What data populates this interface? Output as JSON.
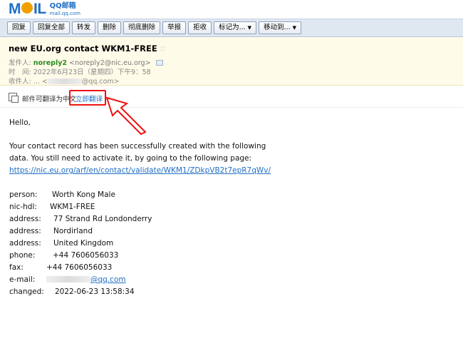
{
  "logo": {
    "mail": "MAIL",
    "qq": "QQ邮箱",
    "url": "mail.qq.com"
  },
  "toolbar": {
    "buttons": [
      "回复",
      "回复全部",
      "转发",
      "删除",
      "彻底删除",
      "举报",
      "拒收"
    ],
    "mark_as": "标记为...",
    "move_to": "移动到..."
  },
  "header": {
    "subject": "new EU.org contact WKM1-FREE",
    "from_label": "发件人:",
    "sender_name": "noreply2",
    "sender_email": "<noreply2@nic.eu.org>",
    "time_label": "时　间:",
    "time_value": "2022年6月23日（星期四）下午9：58",
    "to_label": "收件人:",
    "to_prefix": "...",
    "to_lt": "<",
    "to_suffix": "@qq.com>"
  },
  "translate": {
    "text": "邮件可翻译为中文",
    "link": "立即翻译"
  },
  "body": {
    "greeting": "Hello,",
    "p1": "Your contact record has been successfully created with the following",
    "p2": "data. You still need to activate it, by going to the following page:",
    "url": "https://nic.eu.org/arf/en/contact/validate/WKM1/ZDkpVB2t7epR7qWv/",
    "fields": {
      "person": {
        "label": "person:",
        "value": "Worth Kong Male"
      },
      "nichdl": {
        "label": "nic-hdl:",
        "value": "WKM1-FREE"
      },
      "address1": {
        "label": "address:",
        "value": "77 Strand Rd Londonderry"
      },
      "address2": {
        "label": "address:",
        "value": "Nordirland"
      },
      "address3": {
        "label": "address:",
        "value": "United Kingdom"
      },
      "phone": {
        "label": "phone:",
        "value": "+44 7606056033"
      },
      "fax": {
        "label": "fax:",
        "value": "+44 7606056033"
      },
      "email": {
        "label": "e-mail:",
        "value": "@qq.com"
      },
      "changed": {
        "label": "changed:",
        "value": "2022-06-23 13:58:34"
      }
    }
  },
  "colors": {
    "accent": "#1f6fc5",
    "sender": "#2b8a1e",
    "highlight": "#e11111",
    "header_bg": "#fffbe9",
    "toolbar_bg": "#dfe7f1"
  }
}
